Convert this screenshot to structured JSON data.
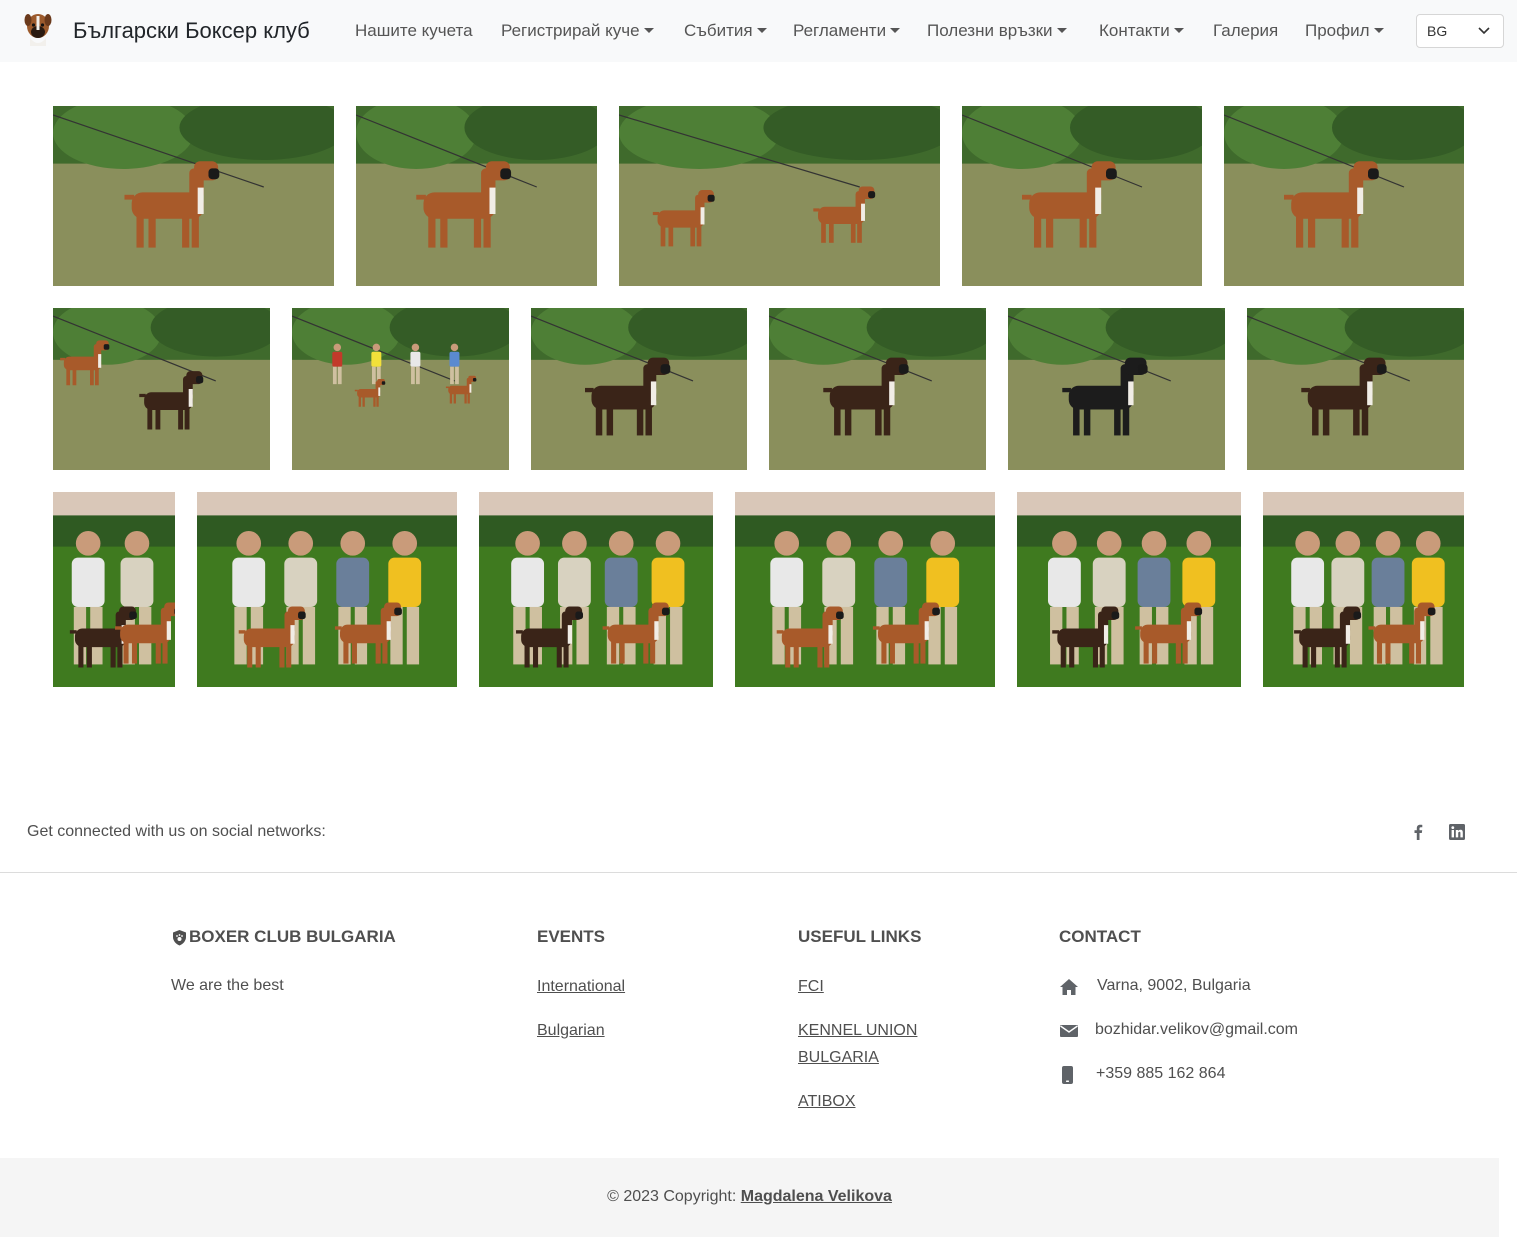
{
  "navbar": {
    "brand": "Български Боксер клуб",
    "items": [
      {
        "label": "Нашите кучета",
        "dropdown": false
      },
      {
        "label": "Регистрирай куче",
        "dropdown": true
      },
      {
        "label": "Събития",
        "dropdown": true
      },
      {
        "label": "Регламенти",
        "dropdown": true
      },
      {
        "label": "Полезни връзки",
        "dropdown": true
      },
      {
        "label": "Контакти",
        "dropdown": true
      },
      {
        "label": "Галерия",
        "dropdown": false
      },
      {
        "label": "Профил",
        "dropdown": true
      }
    ],
    "language": "BG"
  },
  "gallery": {
    "rows": [
      {
        "photos": [
          {
            "icon": "photo-boxer-fawn-standing"
          },
          {
            "icon": "photo-boxer-fawn-standing"
          },
          {
            "icon": "photo-two-boxers"
          },
          {
            "icon": "photo-boxer-fawn-standing"
          },
          {
            "icon": "photo-boxer-fawn-standing"
          }
        ]
      },
      {
        "photos": [
          {
            "icon": "photo-boxers-with-handler"
          },
          {
            "icon": "photo-group-field"
          },
          {
            "icon": "photo-boxer-brindle-standing"
          },
          {
            "icon": "photo-boxer-brindle-standing"
          },
          {
            "icon": "photo-boxer-black-standing"
          },
          {
            "icon": "photo-boxer-brindle-standing"
          }
        ]
      },
      {
        "photos": [
          {
            "icon": "photo-people-with-dog"
          },
          {
            "icon": "photo-award-group"
          },
          {
            "icon": "photo-award-group"
          },
          {
            "icon": "photo-award-group"
          },
          {
            "icon": "photo-award-group"
          },
          {
            "icon": "photo-award-group"
          }
        ]
      }
    ]
  },
  "social": {
    "text": "Get connected with us on social networks:",
    "icons": [
      "facebook-icon",
      "linkedin-icon"
    ]
  },
  "footer": {
    "about": {
      "title": "BOXER CLUB BULGARIA",
      "text": "We are the best"
    },
    "events": {
      "title": "EVENTS",
      "links": [
        "International",
        "Bulgarian"
      ]
    },
    "useful": {
      "title": "USEFUL LINKS",
      "links": [
        "FCI",
        "KENNEL UNION BULGARIA",
        "ATIBOX"
      ]
    },
    "contact": {
      "title": "CONTACT",
      "address": "Varna, 9002, Bulgaria",
      "email": "bozhidar.velikov@gmail.com",
      "phone": "+359 885 162 864"
    },
    "copyright": {
      "prefix": "© 2023 Copyright:",
      "author": "Magdalena Velikova"
    }
  },
  "colors": {
    "grass": "#8a8f5c",
    "bushes": "#3f6a2c",
    "field": "#3f7a1f",
    "fawn": "#a85a2a",
    "brindle": "#3a2418"
  }
}
